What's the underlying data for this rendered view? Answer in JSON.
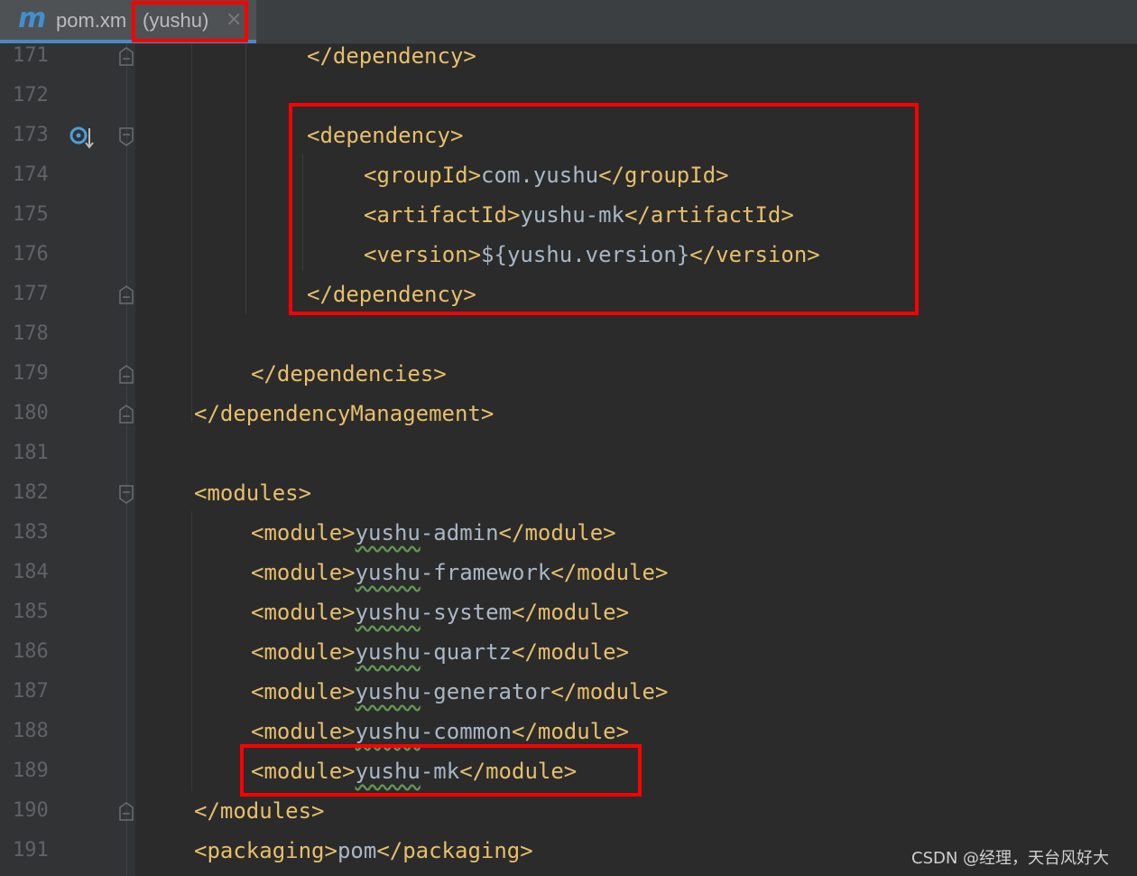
{
  "tab": {
    "icon": "maven-m-icon",
    "icon_glyph": "m",
    "title": "pom.xm",
    "suffix": "(yushu)",
    "close_glyph": "×"
  },
  "lines": [
    {
      "num": "171",
      "open": "</dependency>"
    },
    {
      "num": "172"
    },
    {
      "num": "173",
      "open": "<dependency>"
    },
    {
      "num": "174",
      "open": "<groupId>",
      "value": "com.yushu",
      "close": "</groupId>"
    },
    {
      "num": "175",
      "open": "<artifactId>",
      "value": "yushu-mk",
      "close": "</artifactId>"
    },
    {
      "num": "176",
      "open": "<version>",
      "value": "${yushu.version}",
      "close": "</version>"
    },
    {
      "num": "177",
      "open": "</dependency>"
    },
    {
      "num": "178"
    },
    {
      "num": "179",
      "open": "</dependencies>"
    },
    {
      "num": "180",
      "open": "</dependencyManagement>"
    },
    {
      "num": "181"
    },
    {
      "num": "182",
      "open": "<modules>"
    },
    {
      "num": "183",
      "open": "<module>",
      "value_prefix": "yushu",
      "value_suffix": "-admin",
      "close": "</module>"
    },
    {
      "num": "184",
      "open": "<module>",
      "value_prefix": "yushu",
      "value_suffix": "-framework",
      "close": "</module>"
    },
    {
      "num": "185",
      "open": "<module>",
      "value_prefix": "yushu",
      "value_suffix": "-system",
      "close": "</module>"
    },
    {
      "num": "186",
      "open": "<module>",
      "value_prefix": "yushu",
      "value_suffix": "-quartz",
      "close": "</module>"
    },
    {
      "num": "187",
      "open": "<module>",
      "value_prefix": "yushu",
      "value_suffix": "-generator",
      "close": "</module>"
    },
    {
      "num": "188",
      "open": "<module>",
      "value_prefix": "yushu",
      "value_suffix": "-common",
      "close": "</module>"
    },
    {
      "num": "189",
      "open": "<module>",
      "value_prefix": "yushu",
      "value_suffix": "-mk",
      "close": "</module>"
    },
    {
      "num": "190",
      "open": "</modules>"
    },
    {
      "num": "191",
      "open": "<packaging>",
      "value": "pom",
      "close": "</packaging>"
    }
  ],
  "gutter_icons": {
    "line_173": "override-method-arrow-down-icon"
  },
  "colors": {
    "background": "#2b2b2b",
    "tag": "#e8bf6a",
    "text": "#a9b7c6",
    "line_number": "#606366",
    "highlight_box": "#ff0000",
    "spell_underline": "#629755"
  },
  "watermark": "CSDN @经理，天台风好大"
}
